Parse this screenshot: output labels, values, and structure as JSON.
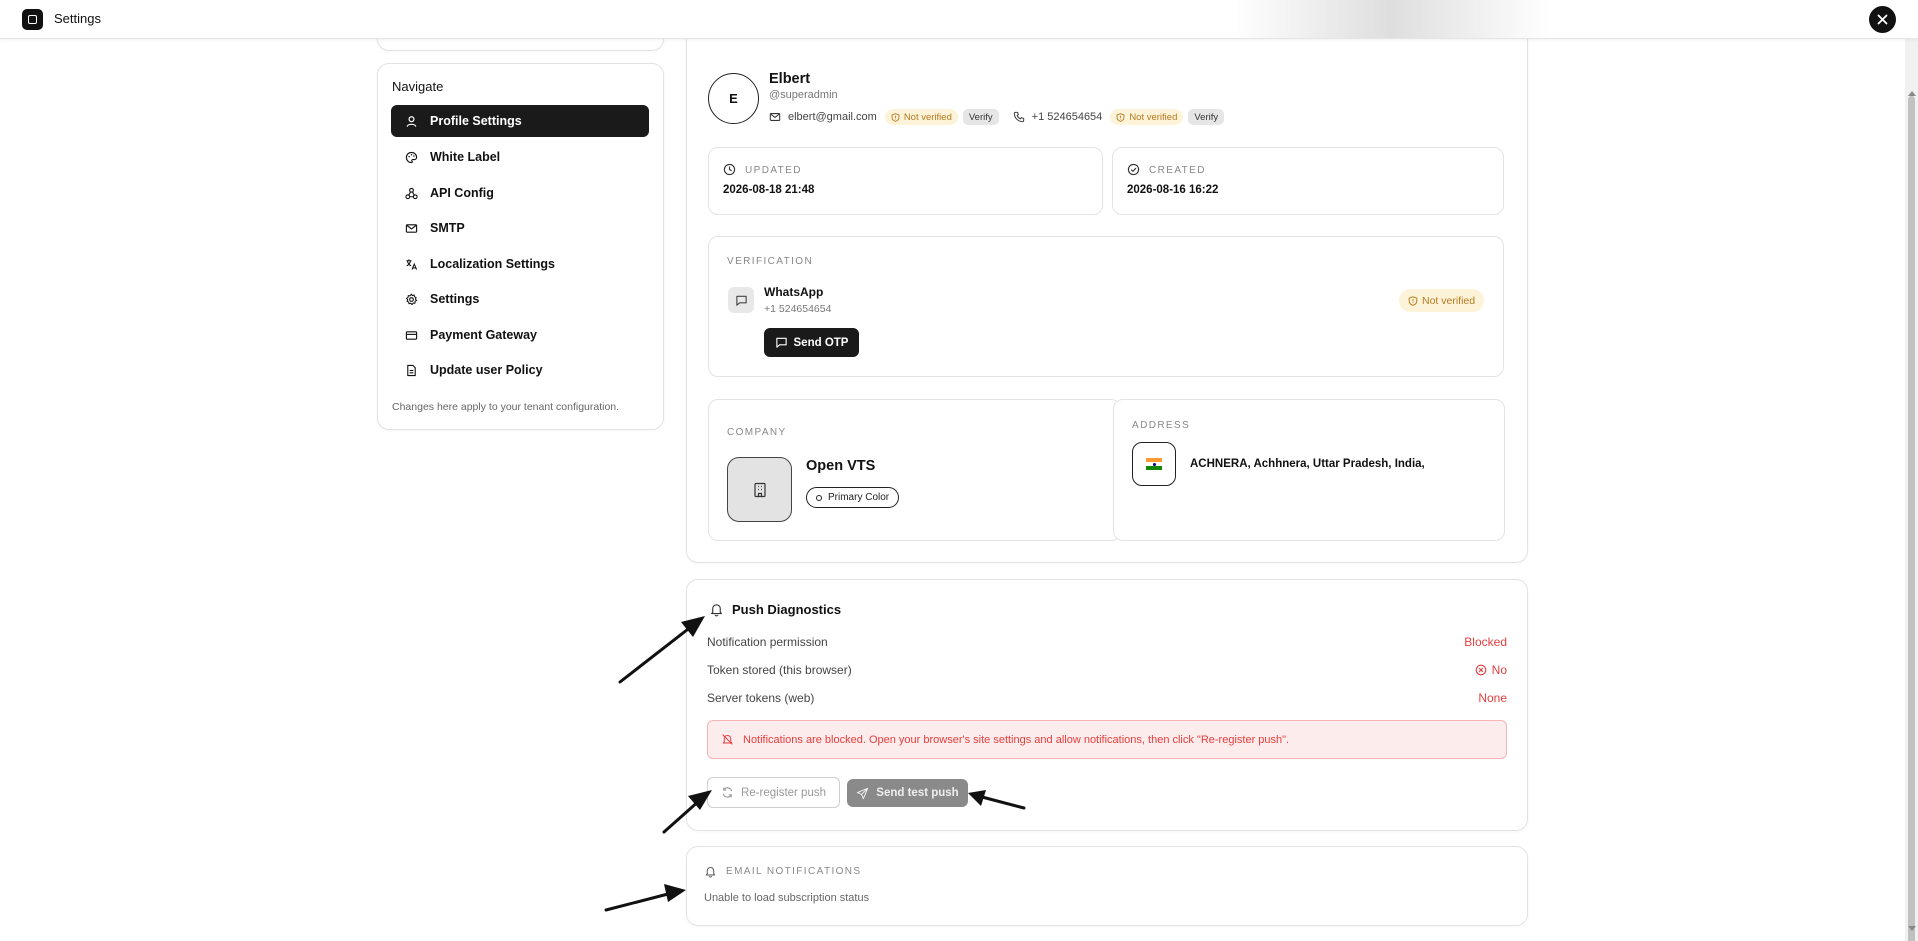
{
  "topbar": {
    "title": "Settings"
  },
  "nav": {
    "heading": "Navigate",
    "items": [
      {
        "label": "Profile Settings",
        "icon": "user-icon",
        "active": true
      },
      {
        "label": "White Label",
        "icon": "palette-icon"
      },
      {
        "label": "API Config",
        "icon": "webhook-icon"
      },
      {
        "label": "SMTP",
        "icon": "mail-icon"
      },
      {
        "label": "Localization Settings",
        "icon": "translate-icon"
      },
      {
        "label": "Settings",
        "icon": "gear-icon"
      },
      {
        "label": "Payment Gateway",
        "icon": "credit-card-icon"
      },
      {
        "label": "Update user Policy",
        "icon": "document-icon"
      }
    ],
    "footer": "Changes here apply to your tenant configuration."
  },
  "profile": {
    "avatar_initial": "E",
    "name": "Elbert",
    "username": "@superadmin",
    "email": "elbert@gmail.com",
    "email_status": "Not verified",
    "email_verify": "Verify",
    "phone": "+1 524654654",
    "phone_status": "Not verified",
    "phone_verify": "Verify",
    "updated_label": "UPDATED",
    "updated_value": "2026-08-18 21:48",
    "created_label": "CREATED",
    "created_value": "2026-08-16 16:22"
  },
  "verification": {
    "label": "VERIFICATION",
    "channel": "WhatsApp",
    "number": "+1 524654654",
    "status": "Not verified",
    "send_otp": "Send OTP"
  },
  "company": {
    "label": "COMPANY",
    "name": "Open VTS",
    "primary_color_label": "Primary Color"
  },
  "address": {
    "label": "ADDRESS",
    "value": "ACHNERA, Achhnera, Uttar Pradesh, India,"
  },
  "push": {
    "title": "Push Diagnostics",
    "rows": [
      {
        "label": "Notification permission",
        "value": "Blocked"
      },
      {
        "label": "Token stored (this browser)",
        "value": "No"
      },
      {
        "label": "Server tokens (web)",
        "value": "None"
      }
    ],
    "alert": "Notifications are blocked. Open your browser's site settings and allow notifications, then click \"Re-register push\".",
    "reregister": "Re-register push",
    "send_test": "Send test push"
  },
  "email_notifications": {
    "label": "EMAIL NOTIFICATIONS",
    "status": "Unable to load subscription status"
  },
  "colors": {
    "accent_dark": "#1a1a1a",
    "warning_bg": "#fdf3d9",
    "warning_text": "#b7791f",
    "error": "#e53e3e",
    "error_bg": "#fdecec"
  }
}
